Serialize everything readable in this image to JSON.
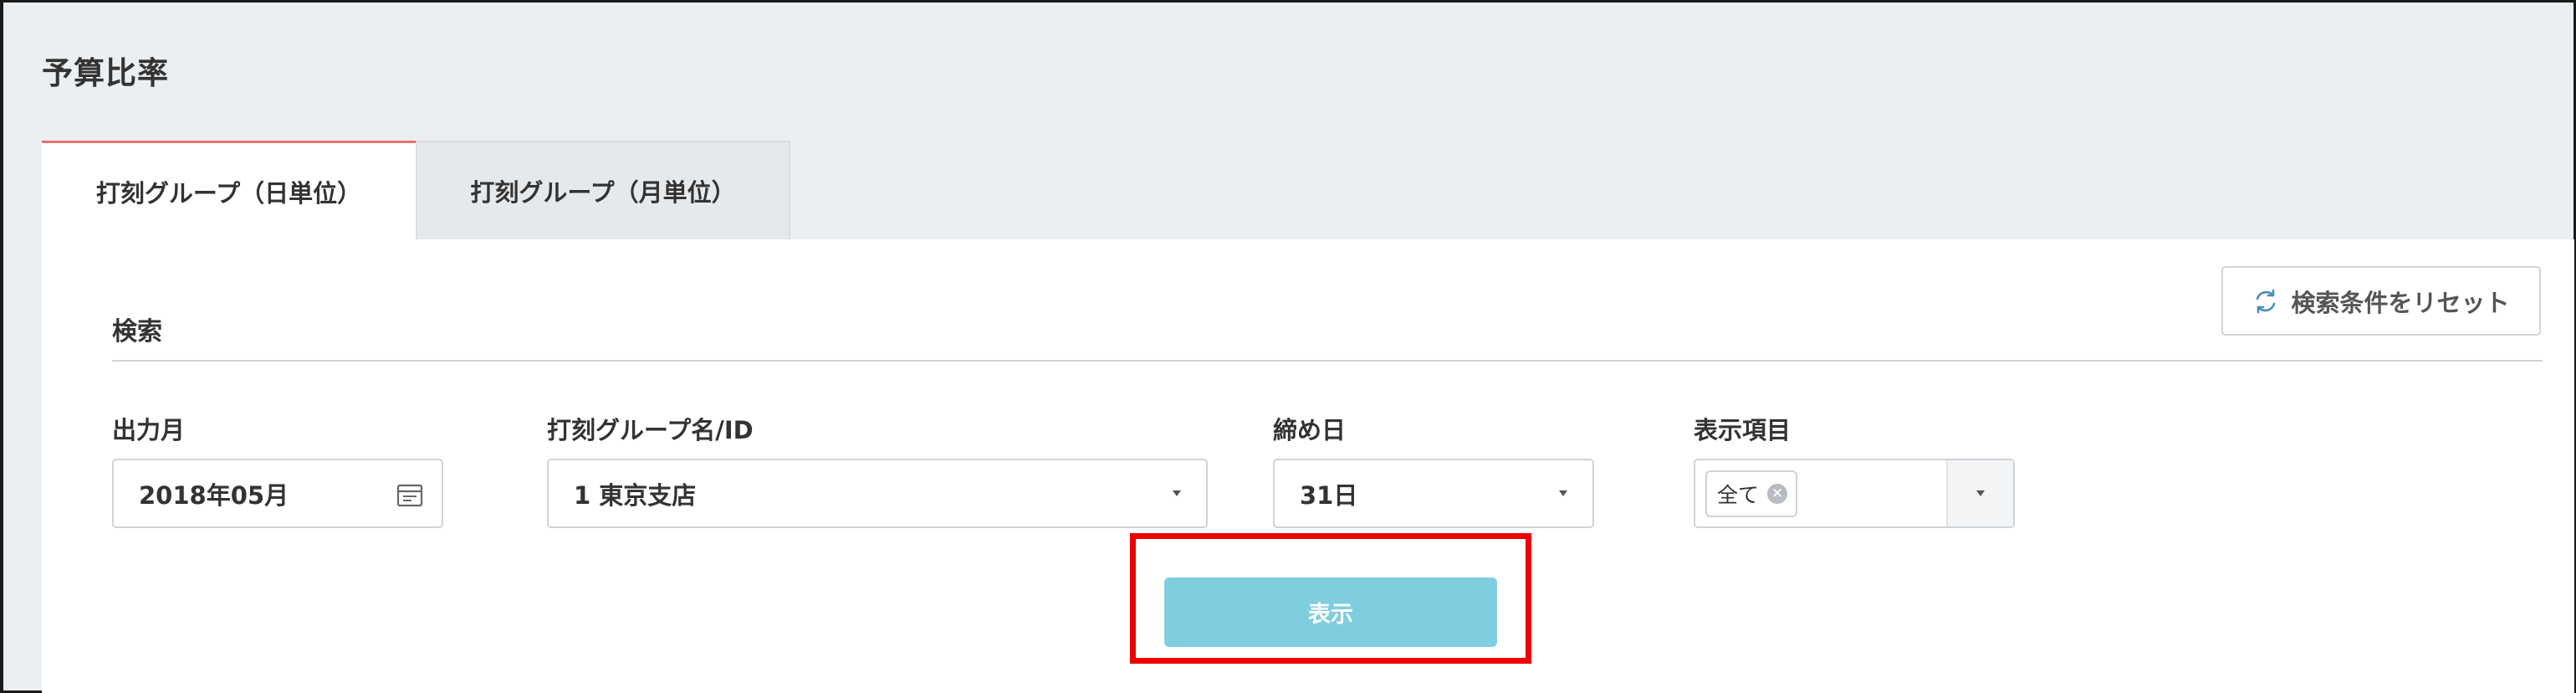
{
  "page": {
    "title": "予算比率"
  },
  "tabs": [
    {
      "label": "打刻グループ（日単位）",
      "active": true
    },
    {
      "label": "打刻グループ（月単位）",
      "active": false
    }
  ],
  "search": {
    "heading": "検索",
    "reset_label": "検索条件をリセット",
    "fields": {
      "month": {
        "label": "出力月",
        "value": "2018年05月"
      },
      "group": {
        "label": "打刻グループ名/ID",
        "value": "1 東京支店"
      },
      "closing": {
        "label": "締め日",
        "value": "31日"
      },
      "display": {
        "label": "表示項目",
        "tag": "全て"
      }
    },
    "submit_label": "表示"
  },
  "icons": {
    "reset": "refresh-icon",
    "month": "calendar-icon",
    "dropdown": "chevron-down-icon",
    "tag_remove": "clear-icon"
  },
  "colors": {
    "tab_accent": "#e8716c",
    "submit_button": "#7ecedf",
    "highlight": "#ee0000"
  }
}
